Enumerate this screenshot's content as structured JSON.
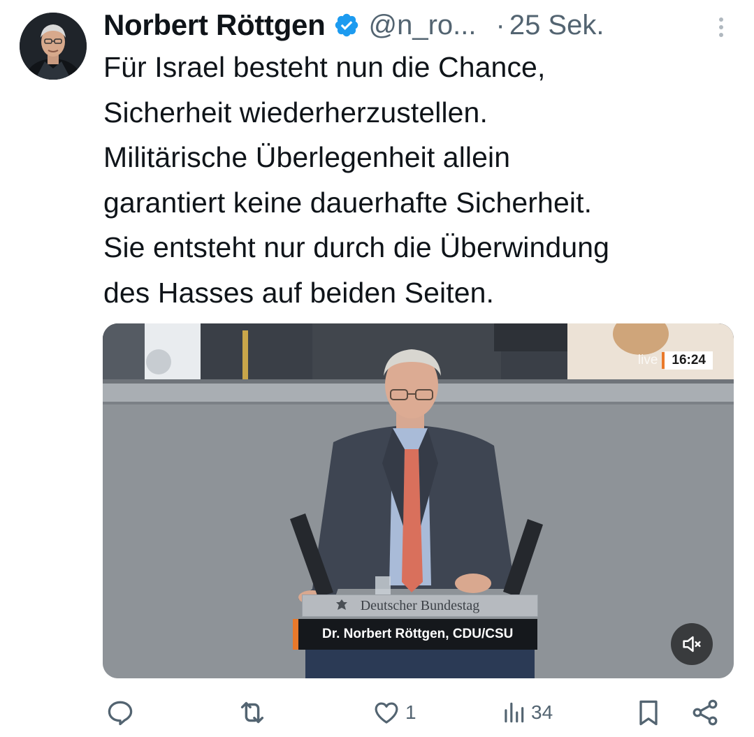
{
  "author": {
    "name": "Norbert Röttgen",
    "handle": "@n_ro...",
    "separator": "·",
    "time": "25 Sek."
  },
  "tweet": {
    "lines": [
      "Für Israel besteht nun die Chance,",
      "Sicherheit wiederherzustellen.",
      "Militärische Überlegenheit allein",
      "garantiert keine dauerhafte Sicherheit.",
      "Sie entsteht nur durch die Überwindung",
      "des Hasses auf beiden Seiten."
    ]
  },
  "media": {
    "live_label": "live",
    "clock": "16:24",
    "lectern_text": "Deutscher Bundestag",
    "lower_third": "Dr. Norbert Röttgen, CDU/CSU"
  },
  "actions": {
    "reply_count": "",
    "retweet_count": "",
    "like_count": "1",
    "views_count": "34"
  },
  "colors": {
    "verified": "#1d9bf0",
    "secondary_text": "#536471",
    "accent_orange": "#e8792b"
  },
  "icons": [
    "verified-badge-icon",
    "more-options-icon",
    "mute-icon",
    "reply-icon",
    "retweet-icon",
    "like-icon",
    "views-icon",
    "bookmark-icon",
    "share-icon"
  ]
}
